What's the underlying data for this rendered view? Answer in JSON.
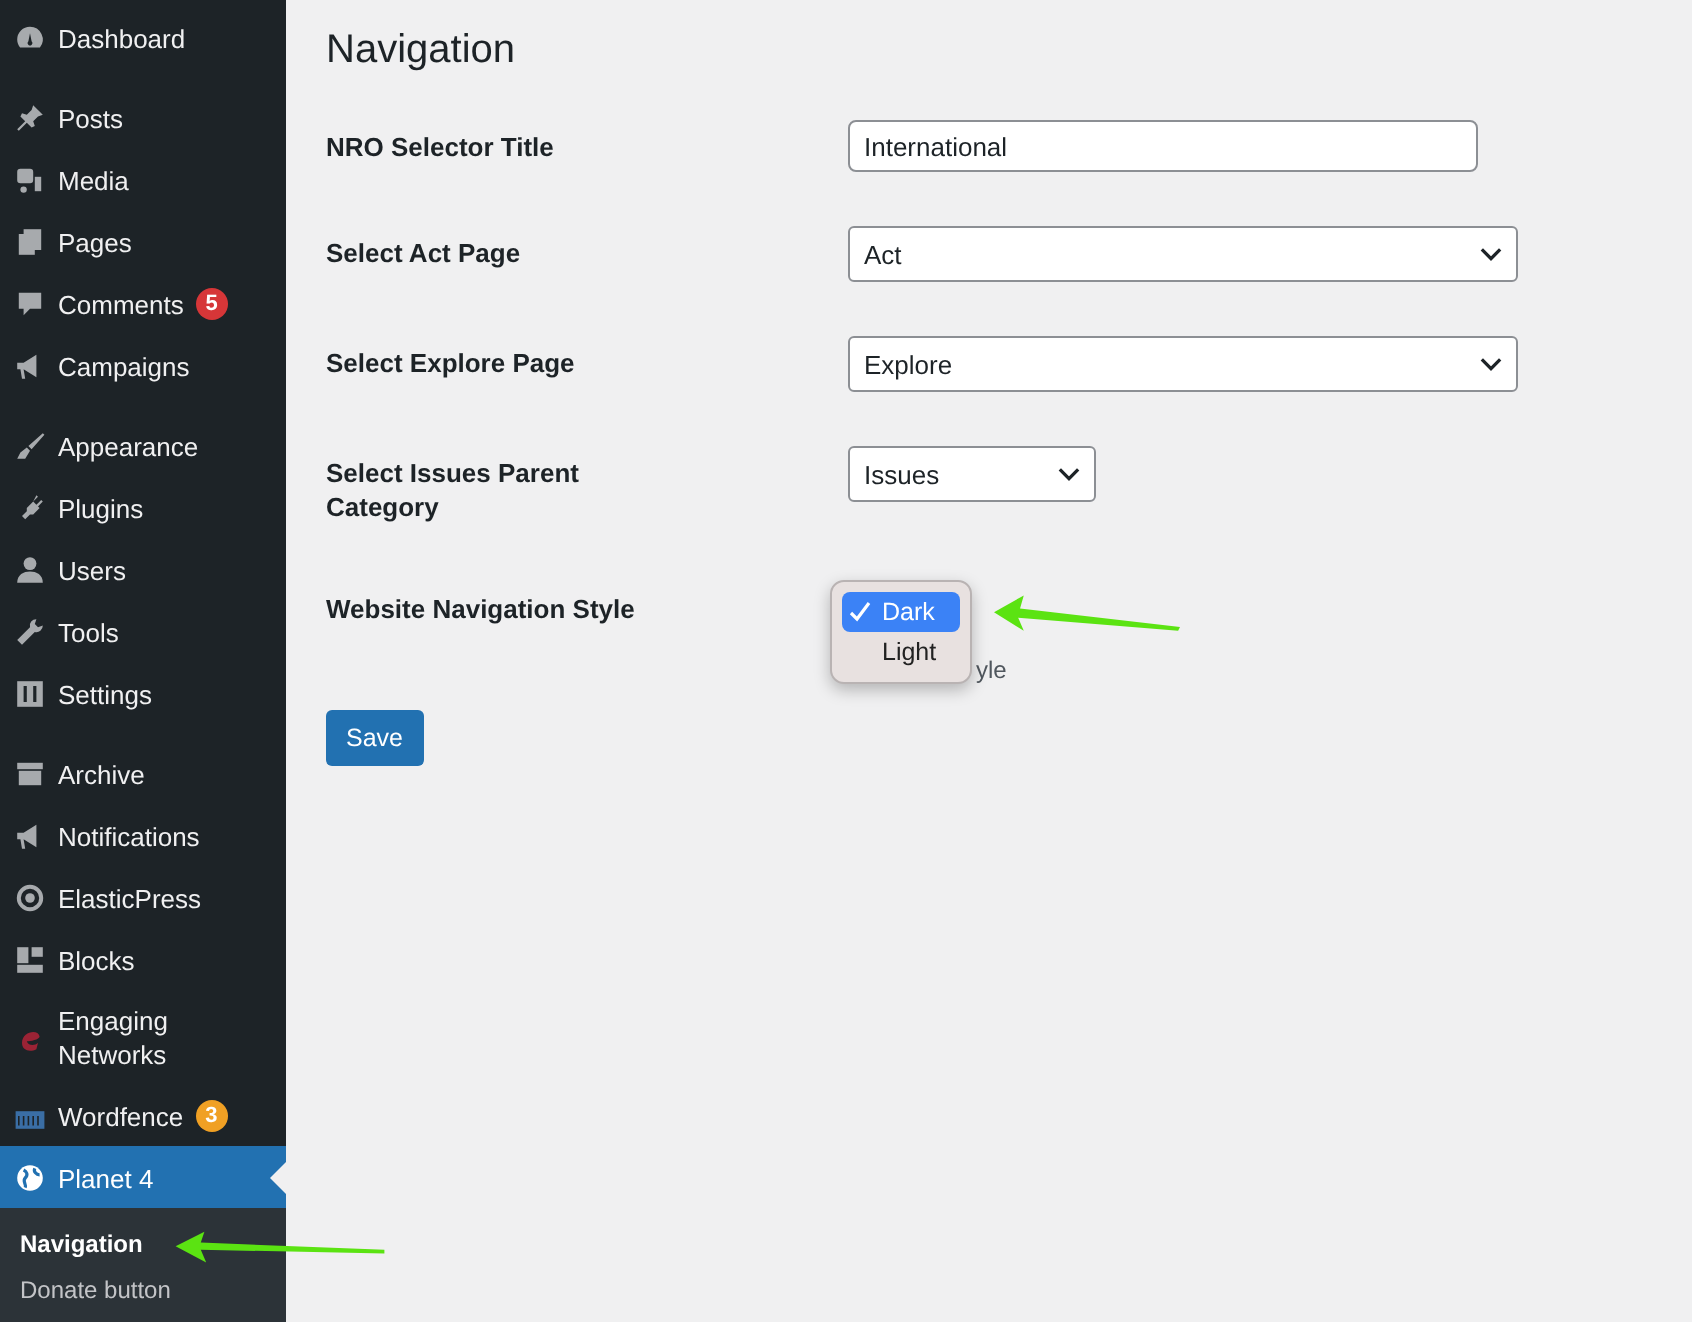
{
  "sidebar": {
    "groups": [
      {
        "items": [
          {
            "label": "Dashboard",
            "selected": false
          }
        ]
      },
      {
        "items": [
          {
            "label": "Posts",
            "selected": false
          },
          {
            "label": "Media",
            "selected": false
          },
          {
            "label": "Pages",
            "selected": false
          },
          {
            "label": "Comments",
            "selected": false,
            "badge": {
              "count": "5",
              "color": "#d63638"
            }
          },
          {
            "label": "Campaigns",
            "selected": false
          }
        ]
      },
      {
        "items": [
          {
            "label": "Appearance",
            "selected": false
          },
          {
            "label": "Plugins",
            "selected": false
          },
          {
            "label": "Users",
            "selected": false
          },
          {
            "label": "Tools",
            "selected": false
          },
          {
            "label": "Settings",
            "selected": false
          }
        ]
      },
      {
        "items": [
          {
            "label": "Archive",
            "selected": false
          },
          {
            "label": "Notifications",
            "selected": false
          },
          {
            "label": "ElasticPress",
            "selected": false
          },
          {
            "label": "Blocks",
            "selected": false
          },
          {
            "label": "Engaging Networks",
            "selected": false
          },
          {
            "label": "Wordfence",
            "selected": false,
            "badge": {
              "count": "3",
              "color": "#f0a024"
            }
          },
          {
            "label": "Planet 4",
            "selected": true,
            "children": [
              {
                "label": "Navigation",
                "selected": true
              },
              {
                "label": "Donate button",
                "selected": false
              }
            ]
          }
        ]
      }
    ]
  },
  "page": {
    "title": "Navigation",
    "fields": [
      {
        "kind": "text",
        "label": "NRO Selector Title",
        "value": "International"
      },
      {
        "kind": "select",
        "label": "Select Act Page",
        "value": "Act"
      },
      {
        "kind": "select",
        "label": "Select Explore Page",
        "value": "Explore"
      },
      {
        "kind": "short-select",
        "label": "Select Issues Parent Category",
        "value": "Issues"
      },
      {
        "kind": "open-select",
        "label": "Website Navigation Style",
        "options": [
          {
            "label": "Dark",
            "selected": true
          },
          {
            "label": "Light",
            "selected": false
          }
        ],
        "description": "yle"
      }
    ],
    "save_button": "Save"
  }
}
